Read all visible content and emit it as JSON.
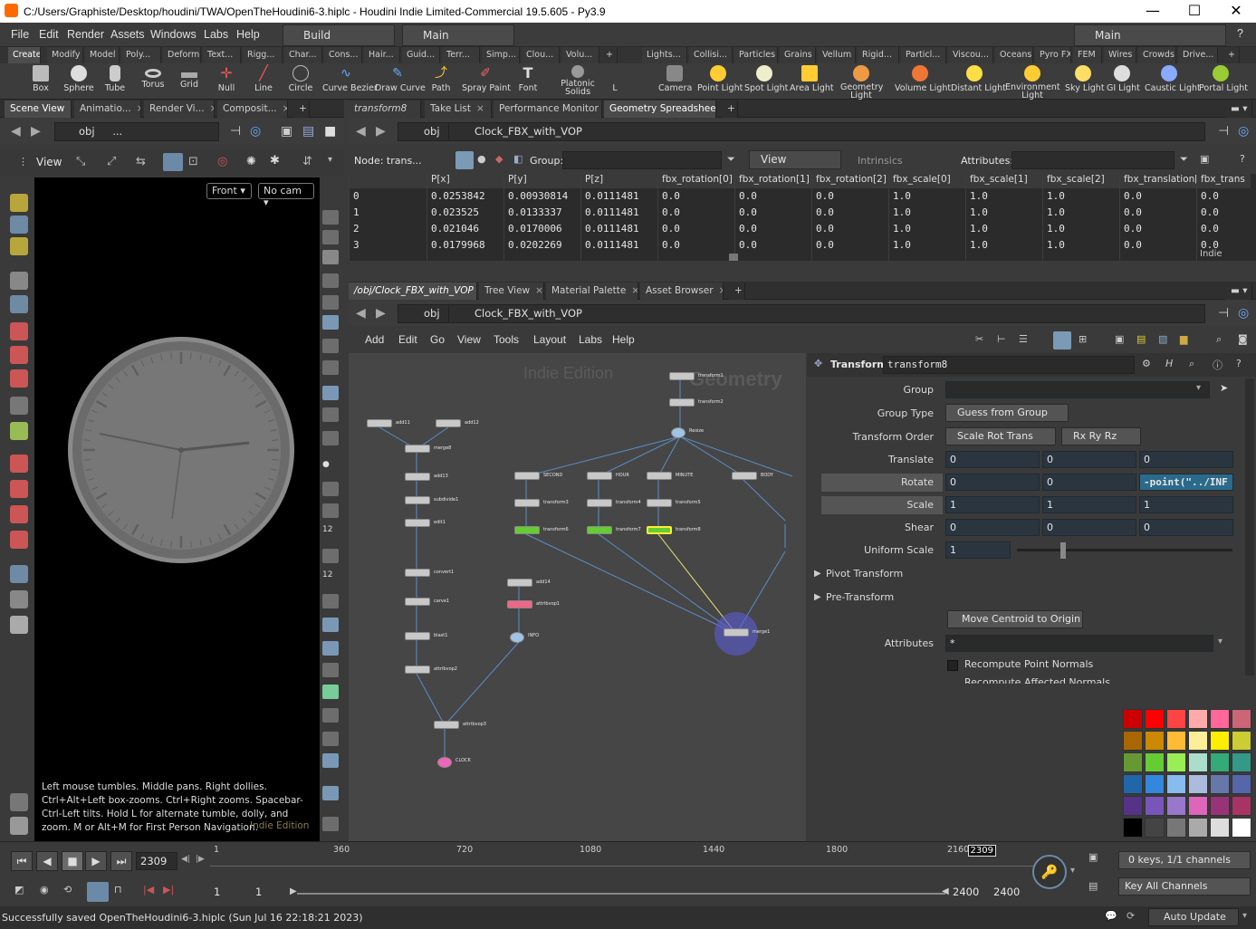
{
  "window": {
    "title": "C:/Users/Graphiste/Desktop/houdini/TWA/OpenTheHoudini6-3.hiplc - Houdini Indie Limited-Commercial 19.5.605 - Py3.9",
    "minimize": "—",
    "maximize": "☐",
    "close": "✕"
  },
  "menu": {
    "items": [
      "File",
      "Edit",
      "Render",
      "Assets",
      "Windows",
      "Labs",
      "Help"
    ],
    "desktop": "Build",
    "context": "Main",
    "right_desktop": "Main"
  },
  "shelf_left": {
    "tabs": [
      "Create",
      "Modify",
      "Model",
      "Poly...",
      "Deform",
      "Text...",
      "Rigg...",
      "Char...",
      "Cons...",
      "Hair...",
      "Guid...",
      "Terr...",
      "Simp...",
      "Clou...",
      "Volu..."
    ],
    "tools": [
      "Box",
      "Sphere",
      "Tube",
      "Torus",
      "Grid",
      "Null",
      "Line",
      "Circle",
      "Curve Bezier",
      "Draw Curve",
      "Path",
      "Spray Paint",
      "Font",
      "Platonic Solids",
      "L"
    ]
  },
  "shelf_right": {
    "tabs": [
      "Lights...",
      "Collisi...",
      "Particles",
      "Grains",
      "Vellum",
      "Rigid...",
      "Particl...",
      "Viscou...",
      "Oceans",
      "Pyro FX",
      "FEM",
      "Wires",
      "Crowds",
      "Drive..."
    ],
    "tools": [
      "Camera",
      "Point Light",
      "Spot Light",
      "Area Light",
      "Geometry Light",
      "Volume Light",
      "Distant Light",
      "Environment Light",
      "Sky Light",
      "GI Light",
      "Caustic Light",
      "Portal Light"
    ]
  },
  "left_pane": {
    "tabs": [
      "Scene View",
      "Animatio...",
      "Render Vi...",
      "Composit..."
    ],
    "path": "obj",
    "path_sub": "...",
    "view_label": "View",
    "front": "Front",
    "nocam": "No cam",
    "help_text": "Left mouse tumbles. Middle pans. Right dollies. Ctrl+Alt+Left box-zooms. Ctrl+Right zooms. Spacebar-Ctrl-Left tilts. Hold L for alternate tumble, dolly, and zoom.    M or Alt+M for First Person Navigation.",
    "watermark": "Indie Edition"
  },
  "top_right_pane": {
    "tabs": [
      "transform8",
      "Take List",
      "Performance Monitor",
      "Geometry Spreadsheet"
    ],
    "path": "obj",
    "node_path": "Clock_FBX_with_VOP",
    "node_label": "Node: trans...",
    "group_label": "Group:",
    "view_dd": "View",
    "intrinsics": "Intrinsics",
    "attributes": "Attributes:",
    "indie": "Indie",
    "columns": [
      "",
      "P[x]",
      "P[y]",
      "P[z]",
      "fbx_rotation[0]",
      "fbx_rotation[1]",
      "fbx_rotation[2]",
      "fbx_scale[0]",
      "fbx_scale[1]",
      "fbx_scale[2]",
      "fbx_translation[",
      "fbx_trans"
    ],
    "rows": [
      [
        "0",
        "0.0253842",
        "0.00930814",
        "0.0111481",
        "0.0",
        "0.0",
        "0.0",
        "1.0",
        "1.0",
        "1.0",
        "0.0",
        "0.0"
      ],
      [
        "1",
        "0.023525",
        "0.0133337",
        "0.0111481",
        "0.0",
        "0.0",
        "0.0",
        "1.0",
        "1.0",
        "1.0",
        "0.0",
        "0.0"
      ],
      [
        "2",
        "0.021046",
        "0.0170006",
        "0.0111481",
        "0.0",
        "0.0",
        "0.0",
        "1.0",
        "1.0",
        "1.0",
        "0.0",
        "0.0"
      ],
      [
        "3",
        "0.0179968",
        "0.0202269",
        "0.0111481",
        "0.0",
        "0.0",
        "0.0",
        "1.0",
        "1.0",
        "1.0",
        "0.0",
        "0.0"
      ]
    ]
  },
  "bottom_right_pane": {
    "tabs": [
      "/obj/Clock_FBX_with_VOP",
      "Tree View",
      "Material Palette",
      "Asset Browser"
    ],
    "path": "obj",
    "node_path": "Clock_FBX_with_VOP",
    "menu": [
      "Add",
      "Edit",
      "Go",
      "View",
      "Tools",
      "Layout",
      "Labs",
      "Help"
    ],
    "watermark1": "Indie Edition",
    "watermark2": "Geometry",
    "nodes": [
      {
        "name": "add11"
      },
      {
        "name": "add12"
      },
      {
        "name": "merge8"
      },
      {
        "name": "add13"
      },
      {
        "name": "subdivide1"
      },
      {
        "name": "edit1"
      },
      {
        "name": "convert1"
      },
      {
        "name": "carve1"
      },
      {
        "name": "blast1"
      },
      {
        "name": "attribvop2"
      },
      {
        "name": "attribvop3"
      },
      {
        "name": "CLOCK"
      },
      {
        "name": "add14"
      },
      {
        "name": "attribvop1"
      },
      {
        "name": "INFO"
      },
      {
        "name": "transform1"
      },
      {
        "name": "transform2"
      },
      {
        "name": "Resize"
      },
      {
        "name": "SECOND"
      },
      {
        "name": "HOUR"
      },
      {
        "name": "MINUTE"
      },
      {
        "name": "BODY"
      },
      {
        "name": "transform3"
      },
      {
        "name": "transform4"
      },
      {
        "name": "transform5"
      },
      {
        "name": "transform6"
      },
      {
        "name": "transform7"
      },
      {
        "name": "transform8"
      },
      {
        "name": "merge1"
      }
    ]
  },
  "params": {
    "type": "Transform",
    "name": "transform8",
    "group_label": "Group",
    "group_type_label": "Group Type",
    "group_type": "Guess from Group",
    "order_label": "Transform Order",
    "order": "Scale Rot Trans",
    "rot_order": "Rx Ry Rz",
    "translate_label": "Translate",
    "translate": [
      "0",
      "0",
      "0"
    ],
    "rotate_label": "Rotate",
    "rotate": [
      "0",
      "0",
      "-point(\"../INF"
    ],
    "scale_label": "Scale",
    "scale": [
      "1",
      "1",
      "1"
    ],
    "shear_label": "Shear",
    "shear": [
      "0",
      "0",
      "0"
    ],
    "uscale_label": "Uniform Scale",
    "uscale": "1",
    "uscale_fraction": 0.2,
    "pivot": "Pivot Transform",
    "pretransform": "Pre-Transform",
    "move_centroid": "Move Centroid to Origin",
    "attributes_label": "Attributes",
    "attributes": "*",
    "recompute": "Recompute Point Normals",
    "recompute2": "Recompute Affected Normals"
  },
  "swatches": [
    "#cc0000",
    "#ff0000",
    "#ff4444",
    "#ffaaaa",
    "#ff6699",
    "#cc6677",
    "#aa6600",
    "#cc8800",
    "#ffbb33",
    "#ffee99",
    "#ffee00",
    "#cccc33",
    "#669933",
    "#66cc33",
    "#99ee55",
    "#aaddcc",
    "#33aa77",
    "#339988",
    "#2266aa",
    "#3388dd",
    "#88bbee",
    "#aabbdd",
    "#6677aa",
    "#5566aa",
    "#553388",
    "#7755bb",
    "#9977cc",
    "#dd66bb",
    "#993377",
    "#aa3366",
    "#000000",
    "#444444",
    "#777777",
    "#aaaaaa",
    "#dddddd",
    "#ffffff"
  ],
  "timeline": {
    "frame": "2309",
    "marker": "2309",
    "ticks": [
      "1",
      "360",
      "720",
      "1080",
      "1440",
      "1800",
      "2160"
    ],
    "start": "1",
    "start2": "1",
    "end": "2400",
    "end2": "2400",
    "keys": "0 keys, 1/1 channels",
    "key_all": "Key All Channels",
    "position_fraction": 0.962
  },
  "status": {
    "message": "Successfully saved OpenTheHoudini6-3.hiplc (Sun Jul 16 22:18:21 2023)",
    "auto_update": "Auto Update"
  }
}
